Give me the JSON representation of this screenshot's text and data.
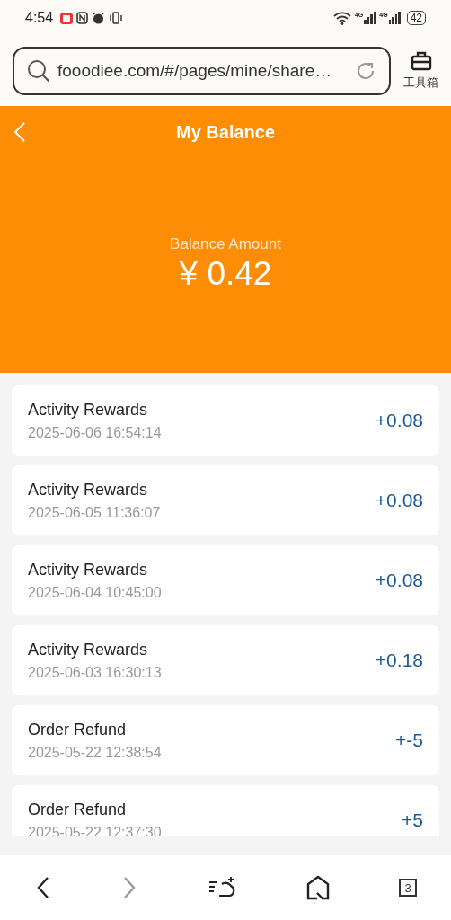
{
  "status_bar": {
    "time": "4:54",
    "network": [
      "4G",
      "4G"
    ],
    "battery": "42"
  },
  "browser": {
    "url": "fooodiee.com/#/pages/mine/share…",
    "toolbox_label": "工具箱"
  },
  "header": {
    "title": "My Balance",
    "balance_label": "Balance Amount",
    "balance": "¥ 0.42"
  },
  "records": [
    {
      "title": "Activity Rewards",
      "time": "2025-06-06 16:54:14",
      "amount": "+0.08"
    },
    {
      "title": "Activity Rewards",
      "time": "2025-06-05 11:36:07",
      "amount": "+0.08"
    },
    {
      "title": "Activity Rewards",
      "time": "2025-06-04 10:45:00",
      "amount": "+0.08"
    },
    {
      "title": "Activity Rewards",
      "time": "2025-06-03 16:30:13",
      "amount": "+0.18"
    },
    {
      "title": "Order Refund",
      "time": "2025-05-22 12:38:54",
      "amount": "+-5"
    },
    {
      "title": "Order Refund",
      "time": "2025-05-22 12:37:30",
      "amount": "+5"
    }
  ],
  "nav": {
    "forward_disabled": true,
    "tab_count": "3"
  }
}
